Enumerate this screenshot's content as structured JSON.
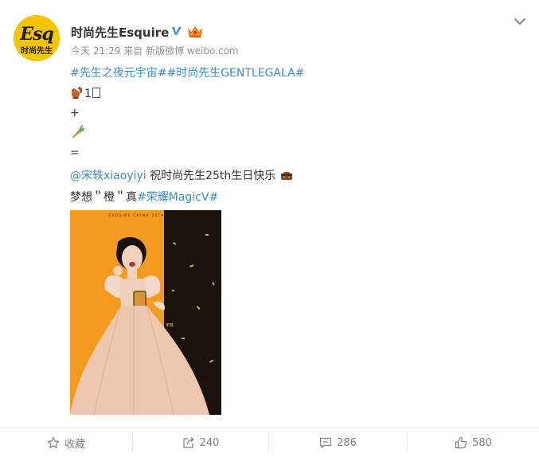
{
  "post": {
    "author": "时尚先生Esquire",
    "avatar_logo": "Esq",
    "avatar_sub": "时尚先生",
    "time": "今天 21:29",
    "source_prefix": "来自",
    "source": "新版微博 weibo.com",
    "hashtag_1": "#先生之夜元宇宙#",
    "hashtag_2": "#时尚先生GENTLEGALA#",
    "line_2_text": "1",
    "line_3_text": "+",
    "line_5_text": "=",
    "mention": "@宋轶xiaoyiyi",
    "line_6_text": " 祝时尚先生25th生日快乐",
    "line_7_text": "梦想＂橙＂真",
    "hashtag_3": "#荣耀MagicV#",
    "image_caption": "ESQUIRE CHINA 25TH PARTY",
    "image_name_tag": "宋轶"
  },
  "actions": {
    "favorite_label": "收藏",
    "repost_count": "240",
    "comment_count": "286",
    "like_count": "580"
  },
  "colors": {
    "link": "#3b8fc6",
    "avatar_bg": "#f5c400",
    "photo_bg": "#f29b1f",
    "muted": "#939393"
  },
  "icons": [
    "verified-icon",
    "crown-icon",
    "chevron-down-icon",
    "squirrel-emoji-icon",
    "carrot-emoji-icon",
    "cake-emoji-icon",
    "star-icon",
    "repost-icon",
    "comment-icon",
    "like-icon"
  ]
}
